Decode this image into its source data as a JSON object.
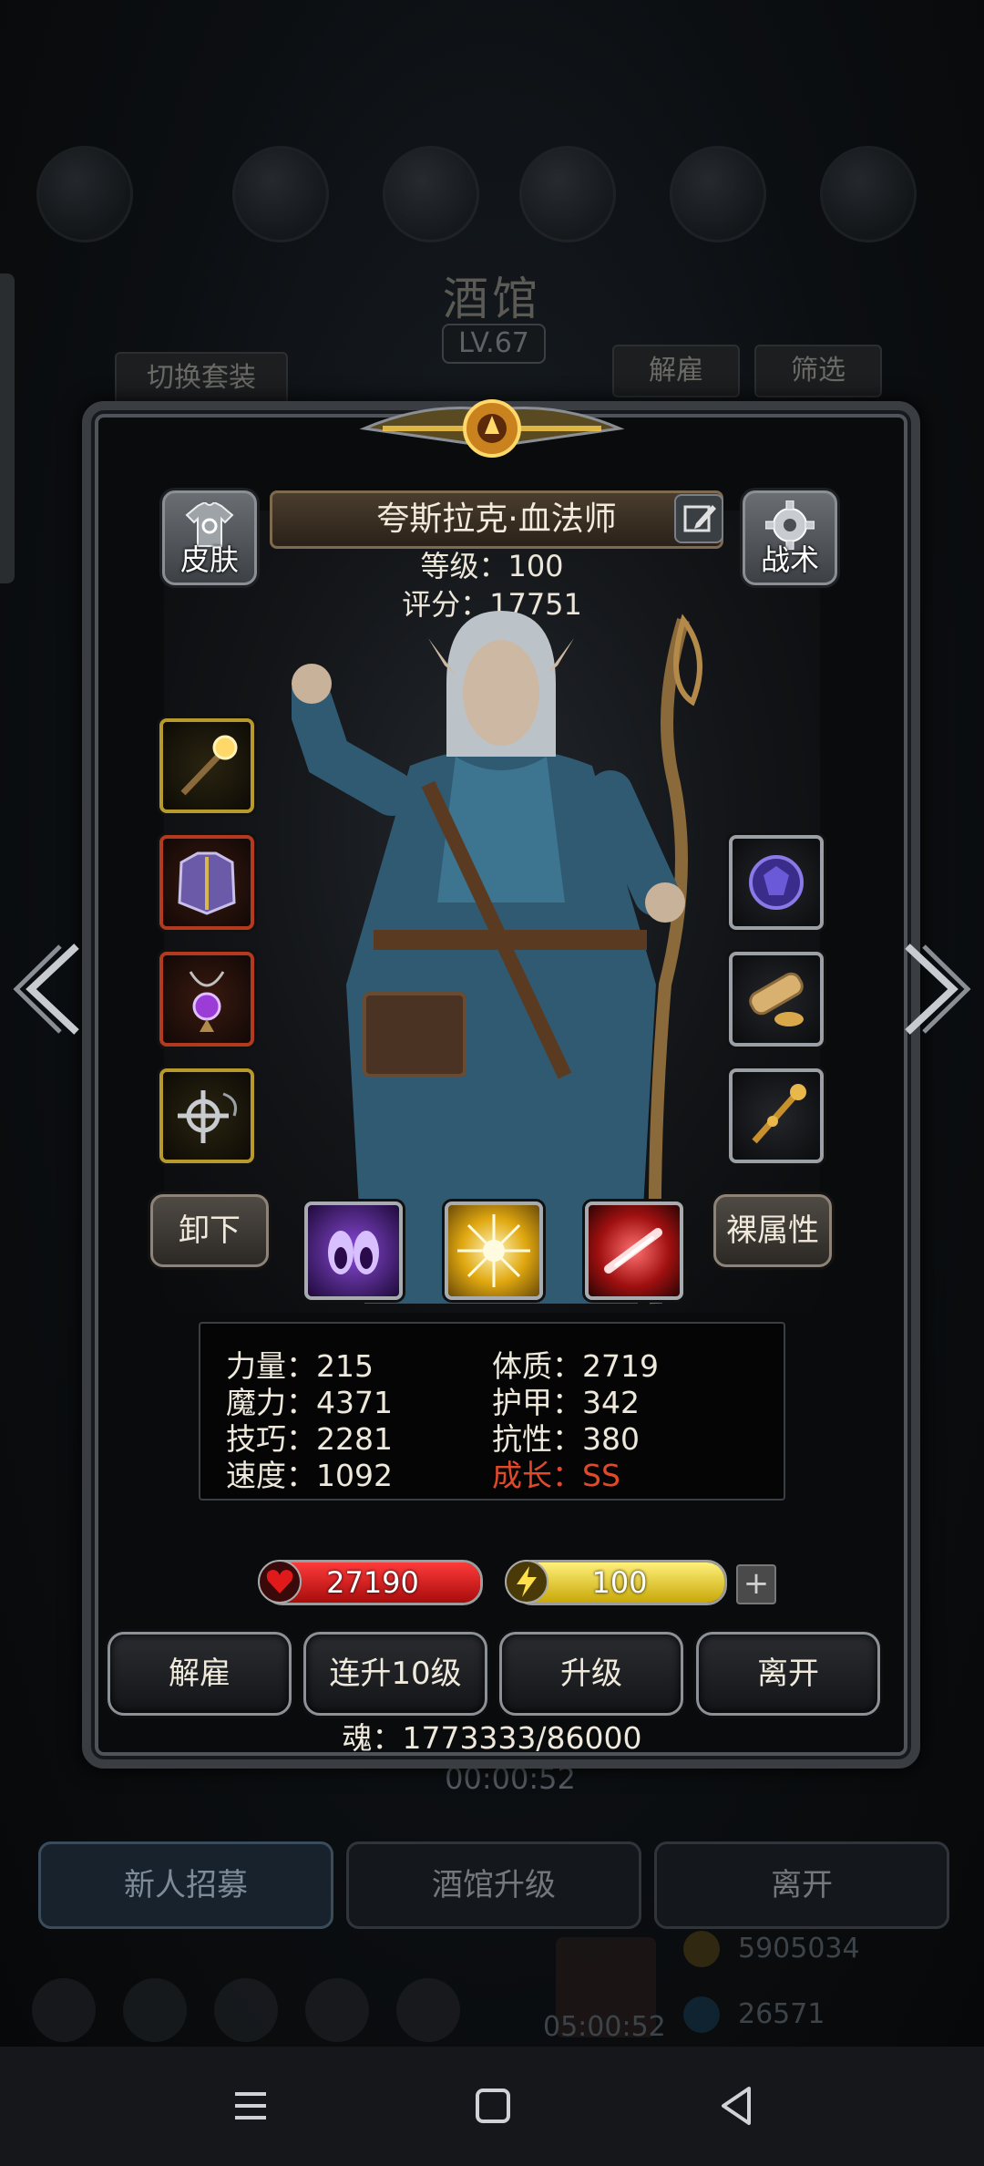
{
  "background": {
    "title": "酒馆",
    "level": "LV.67",
    "switch_outfit": "切换套装",
    "dismiss": "解雇",
    "filter": "筛选",
    "timer": "00:00:52",
    "bottom_buttons": [
      "新人招募",
      "酒馆升级",
      "离开"
    ],
    "gold": "5905034",
    "gems": "26571",
    "gift_timer": "05:00:52"
  },
  "dialog": {
    "skin_label": "皮肤",
    "tactics_label": "战术",
    "hero_name": "夸斯拉克·血法师",
    "level_line": "等级：100",
    "score_line": "评分：17751",
    "unequip_label": "卸下",
    "base_attr_label": "裸属性",
    "stats": {
      "strength": "力量：215",
      "constitution": "体质：2719",
      "magic": "魔力：4371",
      "armor": "护甲：342",
      "skill": "技巧：2281",
      "resistance": "抗性：380",
      "speed": "速度：1092",
      "growth": "成长：SS"
    },
    "hp": "27190",
    "energy": "100",
    "energy_fill": 1.0,
    "hp_fill": 1.0,
    "plus": "+",
    "actions": [
      "解雇",
      "连升10级",
      "升级",
      "离开"
    ],
    "soul": "魂：1773333/86000"
  },
  "colors": {
    "growth": "#e0492a",
    "hp": "#d01818",
    "energy": "#e6cf1a",
    "gold_frame": "#b89a2c",
    "red_frame": "#b33a1e"
  },
  "icons": {
    "left_slots": [
      "staff-icon",
      "chest-armor-icon",
      "amulet-icon",
      "cross-charm-icon"
    ],
    "right_slots": [
      "gem-orb-icon",
      "scroll-icon",
      "scepter-icon"
    ],
    "skills": [
      "shadow-claw-icon",
      "holy-burst-icon",
      "red-slash-icon"
    ]
  }
}
